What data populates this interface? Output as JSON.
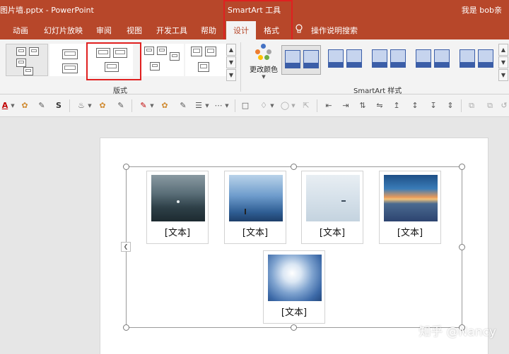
{
  "titlebar": {
    "doc_title": "图片墙.pptx  -  PowerPoint",
    "context_tab": "SmartArt 工具",
    "user": "我是 bob亲"
  },
  "tabs": [
    {
      "label": "动画"
    },
    {
      "label": "幻灯片放映"
    },
    {
      "label": "审阅"
    },
    {
      "label": "视图"
    },
    {
      "label": "开发工具"
    },
    {
      "label": "帮助"
    },
    {
      "label": "设计",
      "active": true
    },
    {
      "label": "格式"
    }
  ],
  "tell_me": "操作说明搜索",
  "ribbon": {
    "layouts_label": "版式",
    "change_colors": "更改颜色",
    "styles_label": "SmartArt 样式"
  },
  "toolbar": {
    "font_color_glyph": "A",
    "shadow_glyph": "S"
  },
  "cards": [
    {
      "caption": "[文本]"
    },
    {
      "caption": "[文本]"
    },
    {
      "caption": "[文本]"
    },
    {
      "caption": "[文本]"
    },
    {
      "caption": "[文本]"
    }
  ],
  "watermark": "知乎 @Nancy",
  "colors": {
    "ribbon_accent": "#b7472a",
    "highlight_box": "#e02020",
    "smartart_style": "#3b5ea8"
  }
}
